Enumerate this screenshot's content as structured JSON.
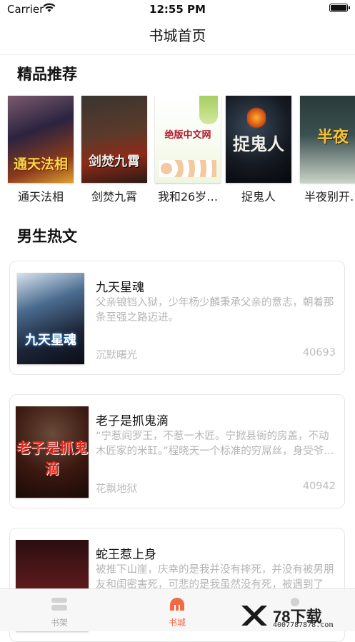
{
  "status": {
    "carrier": "Carrier",
    "time": "12:55 PM"
  },
  "nav": {
    "title": "书城首页"
  },
  "sections": {
    "featured": "精品推荐",
    "hot": "男生热文"
  },
  "featured": [
    {
      "name": "通天法相",
      "cover_text": "通天法相"
    },
    {
      "name": "剑焚九霄",
      "cover_text": "剑焚九霄"
    },
    {
      "name": "我和26岁…",
      "cover_text": "绝版中文网"
    },
    {
      "name": "捉鬼人",
      "cover_text": "捉鬼人"
    },
    {
      "name": "半夜别开…",
      "cover_text": "半夜"
    }
  ],
  "books": [
    {
      "title": "九天星魂",
      "desc": "父亲锒铛入狱，少年杨少麟秉承父亲的意志，朝着那条至强之路迈进。",
      "author": "沉默曙光",
      "count": "40693",
      "cover_text": "九天星魂"
    },
    {
      "title": "老子是抓鬼滴",
      "desc": "“宁惹阎罗王，不惹一木匠。宁掀县衙的房盖，不动木匠家的米缸。”程晓天一个标准的穷屌丝，身受爷爷真传鲁班秘术。因为朋友一场诡异的车祸，坐车…",
      "author": "花飘地狱",
      "count": "40942",
      "cover_text": "老子是抓鬼滴"
    },
    {
      "title": "蛇王惹上身",
      "desc": "被推下山崖，庆幸的是我并没有摔死，并没有被男朋友和闺密害死，可悲的是我虽然没有死，被遇到了",
      "author": "",
      "count": "",
      "cover_text": ""
    }
  ],
  "tabs": [
    {
      "label": "书架",
      "icon": "bookshelf-icon"
    },
    {
      "label": "书城",
      "icon": "bookstore-icon"
    },
    {
      "label": "",
      "icon": "profile-icon"
    }
  ],
  "watermark": {
    "text": "78下载",
    "url": "4007787878.com"
  },
  "colors": {
    "accent": "#ef6b45",
    "muted": "#b5b5b5"
  }
}
